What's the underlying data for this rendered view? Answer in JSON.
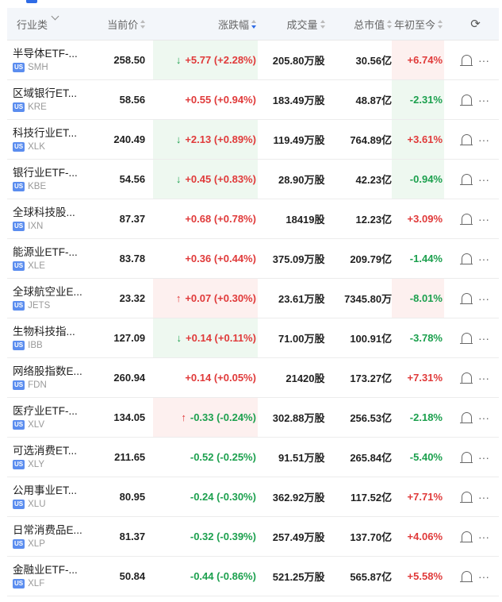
{
  "header": {
    "industry_label": "行业类",
    "price_label": "当前价",
    "change_label": "涨跌幅",
    "volume_label": "成交量",
    "cap_label": "总市值",
    "ytd_label": "年初至今",
    "refresh_icon": "refresh-icon"
  },
  "colors": {
    "up": "#e03a3a",
    "down": "#1ca04e",
    "accent": "#2e6be6"
  },
  "rows": [
    {
      "name": "半导体ETF-...",
      "code": "SMH",
      "market": "US",
      "price": "258.50",
      "arrow": "↓",
      "arrow_dir": "down",
      "change": "+5.77 (+2.28%)",
      "change_dir": "up",
      "chg_bg": "green",
      "volume": "205.80万股",
      "cap": "30.56亿",
      "ytd": "+6.74%",
      "ytd_dir": "up",
      "ytd_bg": "red"
    },
    {
      "name": "区域银行ET...",
      "code": "KRE",
      "market": "US",
      "price": "58.56",
      "arrow": "",
      "arrow_dir": "",
      "change": "+0.55 (+0.94%)",
      "change_dir": "up",
      "chg_bg": "",
      "volume": "183.49万股",
      "cap": "48.87亿",
      "ytd": "-2.31%",
      "ytd_dir": "down",
      "ytd_bg": "green"
    },
    {
      "name": "科技行业ET...",
      "code": "XLK",
      "market": "US",
      "price": "240.49",
      "arrow": "↓",
      "arrow_dir": "down",
      "change": "+2.13 (+0.89%)",
      "change_dir": "up",
      "chg_bg": "green",
      "volume": "119.49万股",
      "cap": "764.89亿",
      "ytd": "+3.61%",
      "ytd_dir": "up",
      "ytd_bg": "green"
    },
    {
      "name": "银行业ETF-...",
      "code": "KBE",
      "market": "US",
      "price": "54.56",
      "arrow": "↓",
      "arrow_dir": "down",
      "change": "+0.45 (+0.83%)",
      "change_dir": "up",
      "chg_bg": "green",
      "volume": "28.90万股",
      "cap": "42.23亿",
      "ytd": "-0.94%",
      "ytd_dir": "down",
      "ytd_bg": "green"
    },
    {
      "name": "全球科技股...",
      "code": "IXN",
      "market": "US",
      "price": "87.37",
      "arrow": "",
      "arrow_dir": "",
      "change": "+0.68 (+0.78%)",
      "change_dir": "up",
      "chg_bg": "",
      "volume": "18419股",
      "cap": "12.23亿",
      "ytd": "+3.09%",
      "ytd_dir": "up",
      "ytd_bg": ""
    },
    {
      "name": "能源业ETF-...",
      "code": "XLE",
      "market": "US",
      "price": "83.78",
      "arrow": "",
      "arrow_dir": "",
      "change": "+0.36 (+0.44%)",
      "change_dir": "up",
      "chg_bg": "",
      "volume": "375.09万股",
      "cap": "209.79亿",
      "ytd": "-1.44%",
      "ytd_dir": "down",
      "ytd_bg": ""
    },
    {
      "name": "全球航空业E...",
      "code": "JETS",
      "market": "US",
      "price": "23.32",
      "arrow": "↑",
      "arrow_dir": "up",
      "change": "+0.07 (+0.30%)",
      "change_dir": "up",
      "chg_bg": "red",
      "volume": "23.61万股",
      "cap": "7345.80万",
      "ytd": "-8.01%",
      "ytd_dir": "down",
      "ytd_bg": "red"
    },
    {
      "name": "生物科技指...",
      "code": "IBB",
      "market": "US",
      "price": "127.09",
      "arrow": "↓",
      "arrow_dir": "down",
      "change": "+0.14 (+0.11%)",
      "change_dir": "up",
      "chg_bg": "green",
      "volume": "71.00万股",
      "cap": "100.91亿",
      "ytd": "-3.78%",
      "ytd_dir": "down",
      "ytd_bg": ""
    },
    {
      "name": "网络股指数E...",
      "code": "FDN",
      "market": "US",
      "price": "260.94",
      "arrow": "",
      "arrow_dir": "",
      "change": "+0.14 (+0.05%)",
      "change_dir": "up",
      "chg_bg": "",
      "volume": "21420股",
      "cap": "173.27亿",
      "ytd": "+7.31%",
      "ytd_dir": "up",
      "ytd_bg": ""
    },
    {
      "name": "医疗业ETF-...",
      "code": "XLV",
      "market": "US",
      "price": "134.05",
      "arrow": "↑",
      "arrow_dir": "up",
      "change": "-0.33 (-0.24%)",
      "change_dir": "down",
      "chg_bg": "red",
      "volume": "302.88万股",
      "cap": "256.53亿",
      "ytd": "-2.18%",
      "ytd_dir": "down",
      "ytd_bg": ""
    },
    {
      "name": "可选消费ET...",
      "code": "XLY",
      "market": "US",
      "price": "211.65",
      "arrow": "",
      "arrow_dir": "",
      "change": "-0.52 (-0.25%)",
      "change_dir": "down",
      "chg_bg": "",
      "volume": "91.51万股",
      "cap": "265.84亿",
      "ytd": "-5.40%",
      "ytd_dir": "down",
      "ytd_bg": ""
    },
    {
      "name": "公用事业ET...",
      "code": "XLU",
      "market": "US",
      "price": "80.95",
      "arrow": "",
      "arrow_dir": "",
      "change": "-0.24 (-0.30%)",
      "change_dir": "down",
      "chg_bg": "",
      "volume": "362.92万股",
      "cap": "117.52亿",
      "ytd": "+7.71%",
      "ytd_dir": "up",
      "ytd_bg": ""
    },
    {
      "name": "日常消费品E...",
      "code": "XLP",
      "market": "US",
      "price": "81.37",
      "arrow": "",
      "arrow_dir": "",
      "change": "-0.32 (-0.39%)",
      "change_dir": "down",
      "chg_bg": "",
      "volume": "257.49万股",
      "cap": "137.70亿",
      "ytd": "+4.06%",
      "ytd_dir": "up",
      "ytd_bg": ""
    },
    {
      "name": "金融业ETF-...",
      "code": "XLF",
      "market": "US",
      "price": "50.84",
      "arrow": "",
      "arrow_dir": "",
      "change": "-0.44 (-0.86%)",
      "change_dir": "down",
      "chg_bg": "",
      "volume": "521.25万股",
      "cap": "565.87亿",
      "ytd": "+5.58%",
      "ytd_dir": "up",
      "ytd_bg": ""
    }
  ]
}
